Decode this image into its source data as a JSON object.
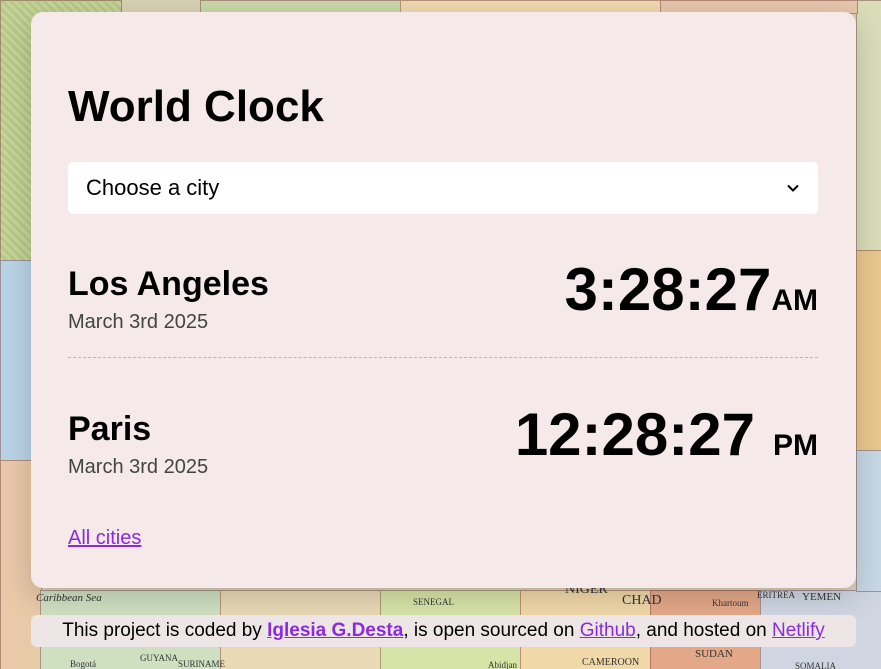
{
  "app": {
    "title": "World Clock"
  },
  "city_select": {
    "placeholder": "Choose a city"
  },
  "cities": [
    {
      "name": "Los Angeles",
      "date": "March 3rd 2025",
      "time": "3:28:27",
      "ampm": "AM"
    },
    {
      "name": "Paris",
      "date": "March 3rd 2025",
      "time": "12:28:27",
      "ampm": "PM"
    }
  ],
  "all_cities_link": "All cities",
  "footer": {
    "prefix": "This project is coded by ",
    "author": "Iglesia G.Desta",
    "middle1": ", is open sourced on ",
    "github": "Github",
    "middle2": ", and hosted on ",
    "netlify": "Netlify"
  },
  "map_labels": [
    "Caribbean Sea",
    "CHAD",
    "NIGER",
    "YEMEN",
    "SUDAN",
    "CAMEROON",
    "SENEGAL",
    "GUYANA",
    "SURINAME",
    "Bogotá",
    "Khartoum",
    "ERITREA",
    "SOMALIA",
    "Abidjan"
  ],
  "colors": {
    "accent": "#8a2be2",
    "card_bg": "#f5e9e9"
  }
}
